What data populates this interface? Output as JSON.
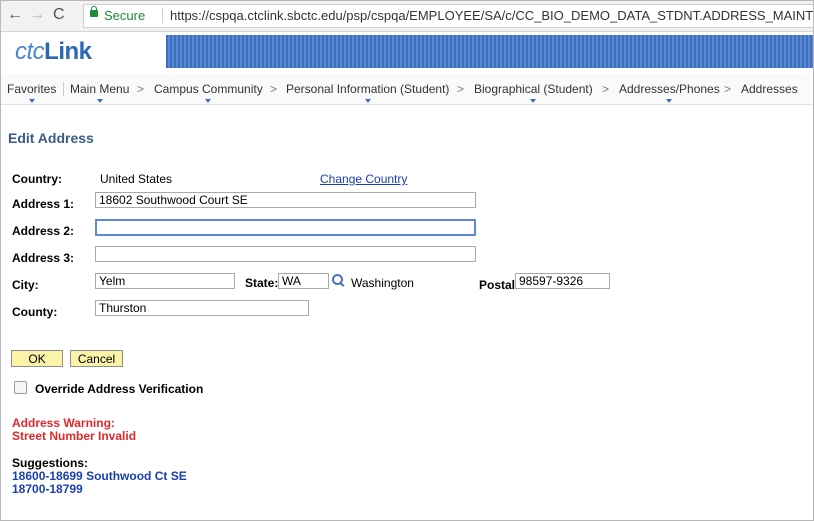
{
  "browser": {
    "back": "←",
    "forward": "→",
    "reload": "C",
    "secure_label": "Secure",
    "url": "https://cspqa.ctclink.sbctc.edu/psp/cspqa/EMPLOYEE/SA/c/CC_BIO_DEMO_DATA_STDNT.ADDRESS_MAINT.G"
  },
  "logo": {
    "prefix": "ctc",
    "suffix": "Link"
  },
  "menu": {
    "items": [
      "Favorites",
      "Main Menu",
      "Campus Community",
      "Personal Information (Student)",
      "Biographical (Student)",
      "Addresses/Phones",
      "Addresses"
    ],
    "separator": ">"
  },
  "page": {
    "title": "Edit Address",
    "country_label": "Country:",
    "country_value": "United States",
    "change_country": "Change Country",
    "address1_label": "Address 1:",
    "address1_value": "18602 Southwood Court SE",
    "address2_label": "Address 2:",
    "address2_value": "",
    "address3_label": "Address 3:",
    "address3_value": "",
    "city_label": "City:",
    "city_value": "Yelm",
    "state_label": "State:",
    "state_value": "WA",
    "state_name": "Washington",
    "postal_label": "Postal:",
    "postal_value": "98597-9326",
    "county_label": "County:",
    "county_value": "Thurston"
  },
  "actions": {
    "ok": "OK",
    "cancel": "Cancel"
  },
  "override": {
    "label": "Override Address Verification",
    "checked": false
  },
  "warning": {
    "line1": "Address Warning:",
    "line2": "Street Number Invalid"
  },
  "suggestions": {
    "heading": "Suggestions:",
    "items": [
      "18600-18699 Southwood Ct SE",
      "18700-18799"
    ]
  }
}
